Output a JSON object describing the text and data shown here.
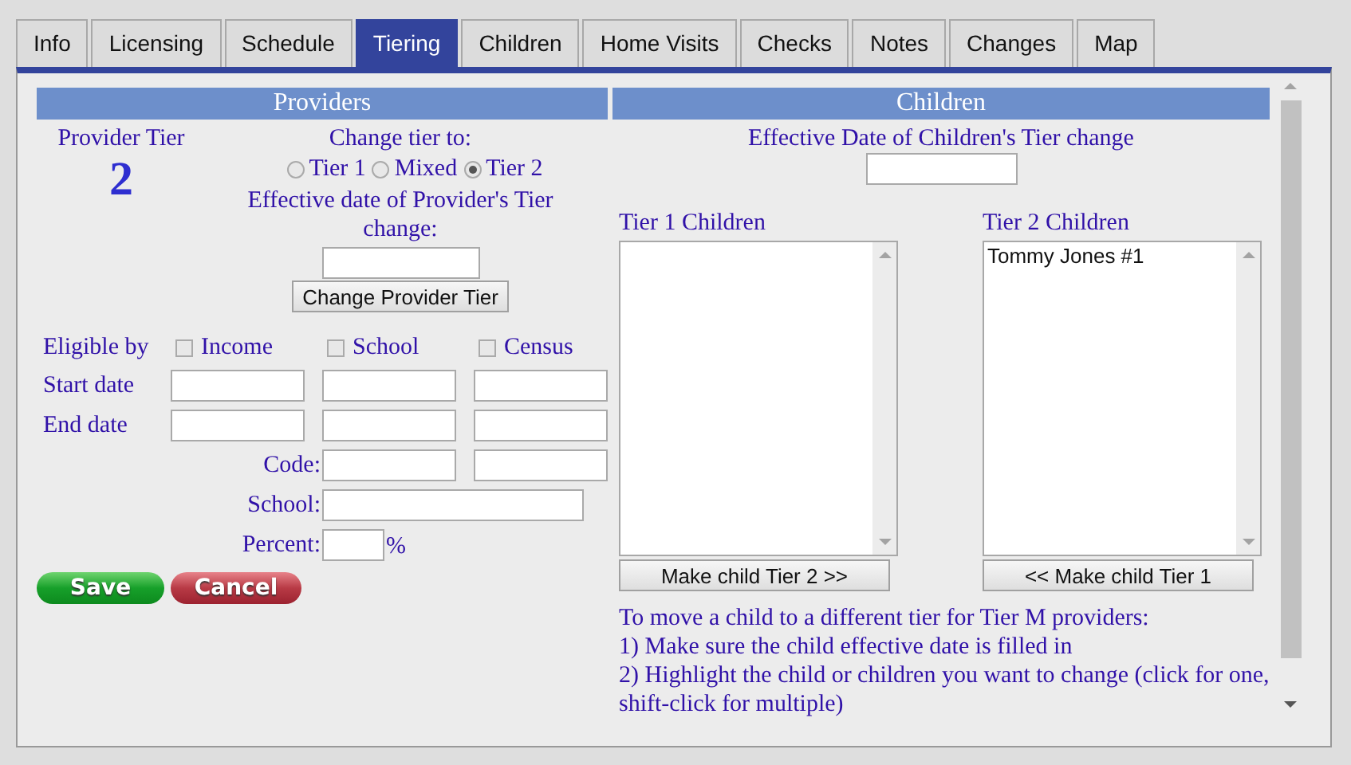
{
  "tabs": [
    {
      "label": "Info",
      "selected": false
    },
    {
      "label": "Licensing",
      "selected": false
    },
    {
      "label": "Schedule",
      "selected": false
    },
    {
      "label": "Tiering",
      "selected": true
    },
    {
      "label": "Children",
      "selected": false
    },
    {
      "label": "Home Visits",
      "selected": false
    },
    {
      "label": "Checks",
      "selected": false
    },
    {
      "label": "Notes",
      "selected": false
    },
    {
      "label": "Changes",
      "selected": false
    },
    {
      "label": "Map",
      "selected": false
    }
  ],
  "providers": {
    "title": "Providers",
    "tier_label": "Provider Tier",
    "tier_value": "2",
    "change_label": "Change tier to:",
    "tier_options": [
      {
        "label": "Tier 1",
        "selected": false
      },
      {
        "label": "Mixed",
        "selected": false
      },
      {
        "label": "Tier 2",
        "selected": true
      }
    ],
    "effective_label": "Effective date of Provider's Tier change:",
    "change_button": "Change Provider Tier",
    "eligible_label": "Eligible by",
    "eligible_options": [
      {
        "label": "Income",
        "checked": false
      },
      {
        "label": "School",
        "checked": false
      },
      {
        "label": "Census",
        "checked": false
      }
    ],
    "start_label": "Start date",
    "end_label": "End date",
    "code_label": "Code:",
    "school_label": "School:",
    "percent_label": "Percent:",
    "percent_unit": "%",
    "save_button": "Save",
    "cancel_button": "Cancel"
  },
  "children": {
    "title": "Children",
    "effective_label": "Effective Date of Children's Tier change",
    "tier1_label": "Tier 1 Children",
    "tier2_label": "Tier 2 Children",
    "tier2_items": [
      "Tommy Jones #1"
    ],
    "to_tier2_button": "Make child Tier 2 >>",
    "to_tier1_button": "<< Make child Tier 1",
    "instructions": [
      "To move a child to a different tier for Tier M providers:",
      "1) Make sure the child effective date is filled in",
      "2) Highlight the child or children you want to change (click for one, shift-click for multiple)"
    ]
  }
}
